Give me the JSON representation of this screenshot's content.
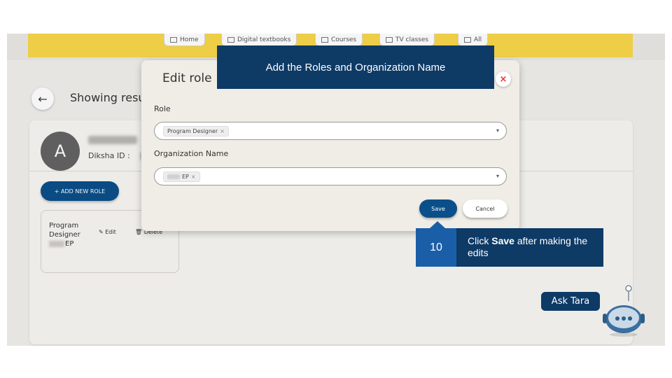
{
  "nav": {
    "items": [
      {
        "label": "Home",
        "icon": "home-icon"
      },
      {
        "label": "Digital textbooks",
        "icon": "book-icon"
      },
      {
        "label": "Courses",
        "icon": "course-icon"
      },
      {
        "label": "TV classes",
        "icon": "tv-icon"
      },
      {
        "label": "All",
        "icon": "grid-icon"
      }
    ]
  },
  "page": {
    "back_icon": "←",
    "results_text": "Showing resu",
    "profile": {
      "avatar_letter": "A",
      "diksha_id_label": "Diksha ID :"
    },
    "add_role_label": "+ ADD NEW ROLE",
    "role_card": {
      "role": "Program Designer",
      "org": "EP",
      "edit_label": "✎ Edit",
      "delete_label": "🗑 Delete"
    }
  },
  "modal": {
    "title": "Edit role",
    "close_glyph": "×",
    "role_label": "Role",
    "role_chip": "Program Designer",
    "org_label": "Organization Name",
    "org_chip": "EP",
    "chip_remove": "×",
    "caret": "▾",
    "save_label": "Save",
    "cancel_label": "Cancel"
  },
  "tutorial": {
    "top_callout": "Add the Roles and Organization Name",
    "step_number": "10",
    "step_prefix": "Click ",
    "step_bold": "Save",
    "step_suffix": " after making the edits"
  },
  "assistant": {
    "label": "Ask Tara"
  },
  "colors": {
    "primary": "#0b4f8a",
    "callout": "#0e3a66",
    "step_accent": "#1b5ea8",
    "banner": "#f8d64a",
    "close": "#e33333"
  }
}
